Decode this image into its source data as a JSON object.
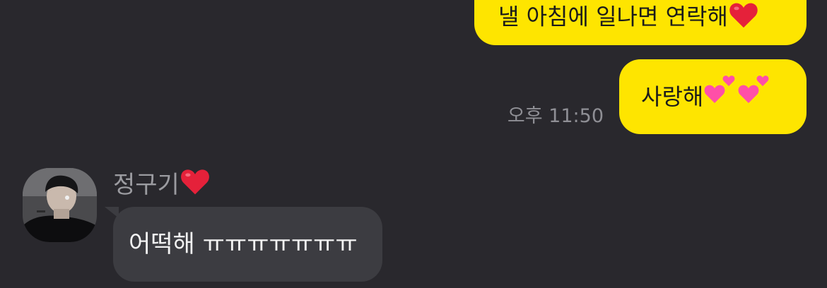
{
  "chat": {
    "outgoing": [
      {
        "text": "낼 아침에 일나면 연락해",
        "emoji_icon": "red-heart-icon"
      },
      {
        "text": "사랑해",
        "emoji_icon": "two-hearts-icon"
      }
    ],
    "timestamp": "오후 11:50",
    "incoming": {
      "sender_name": "정구기",
      "sender_emoji_icon": "red-heart-icon",
      "avatar_icon": "profile-photo",
      "message": "어떡해 ㅠㅠㅠㅠㅠㅠㅠ"
    }
  },
  "colors": {
    "background": "#29282d",
    "outgoing_bubble": "#fee500",
    "incoming_bubble": "#3c3c41",
    "heart_red": "#e5213a",
    "heart_pink": "#ff4fa8"
  }
}
